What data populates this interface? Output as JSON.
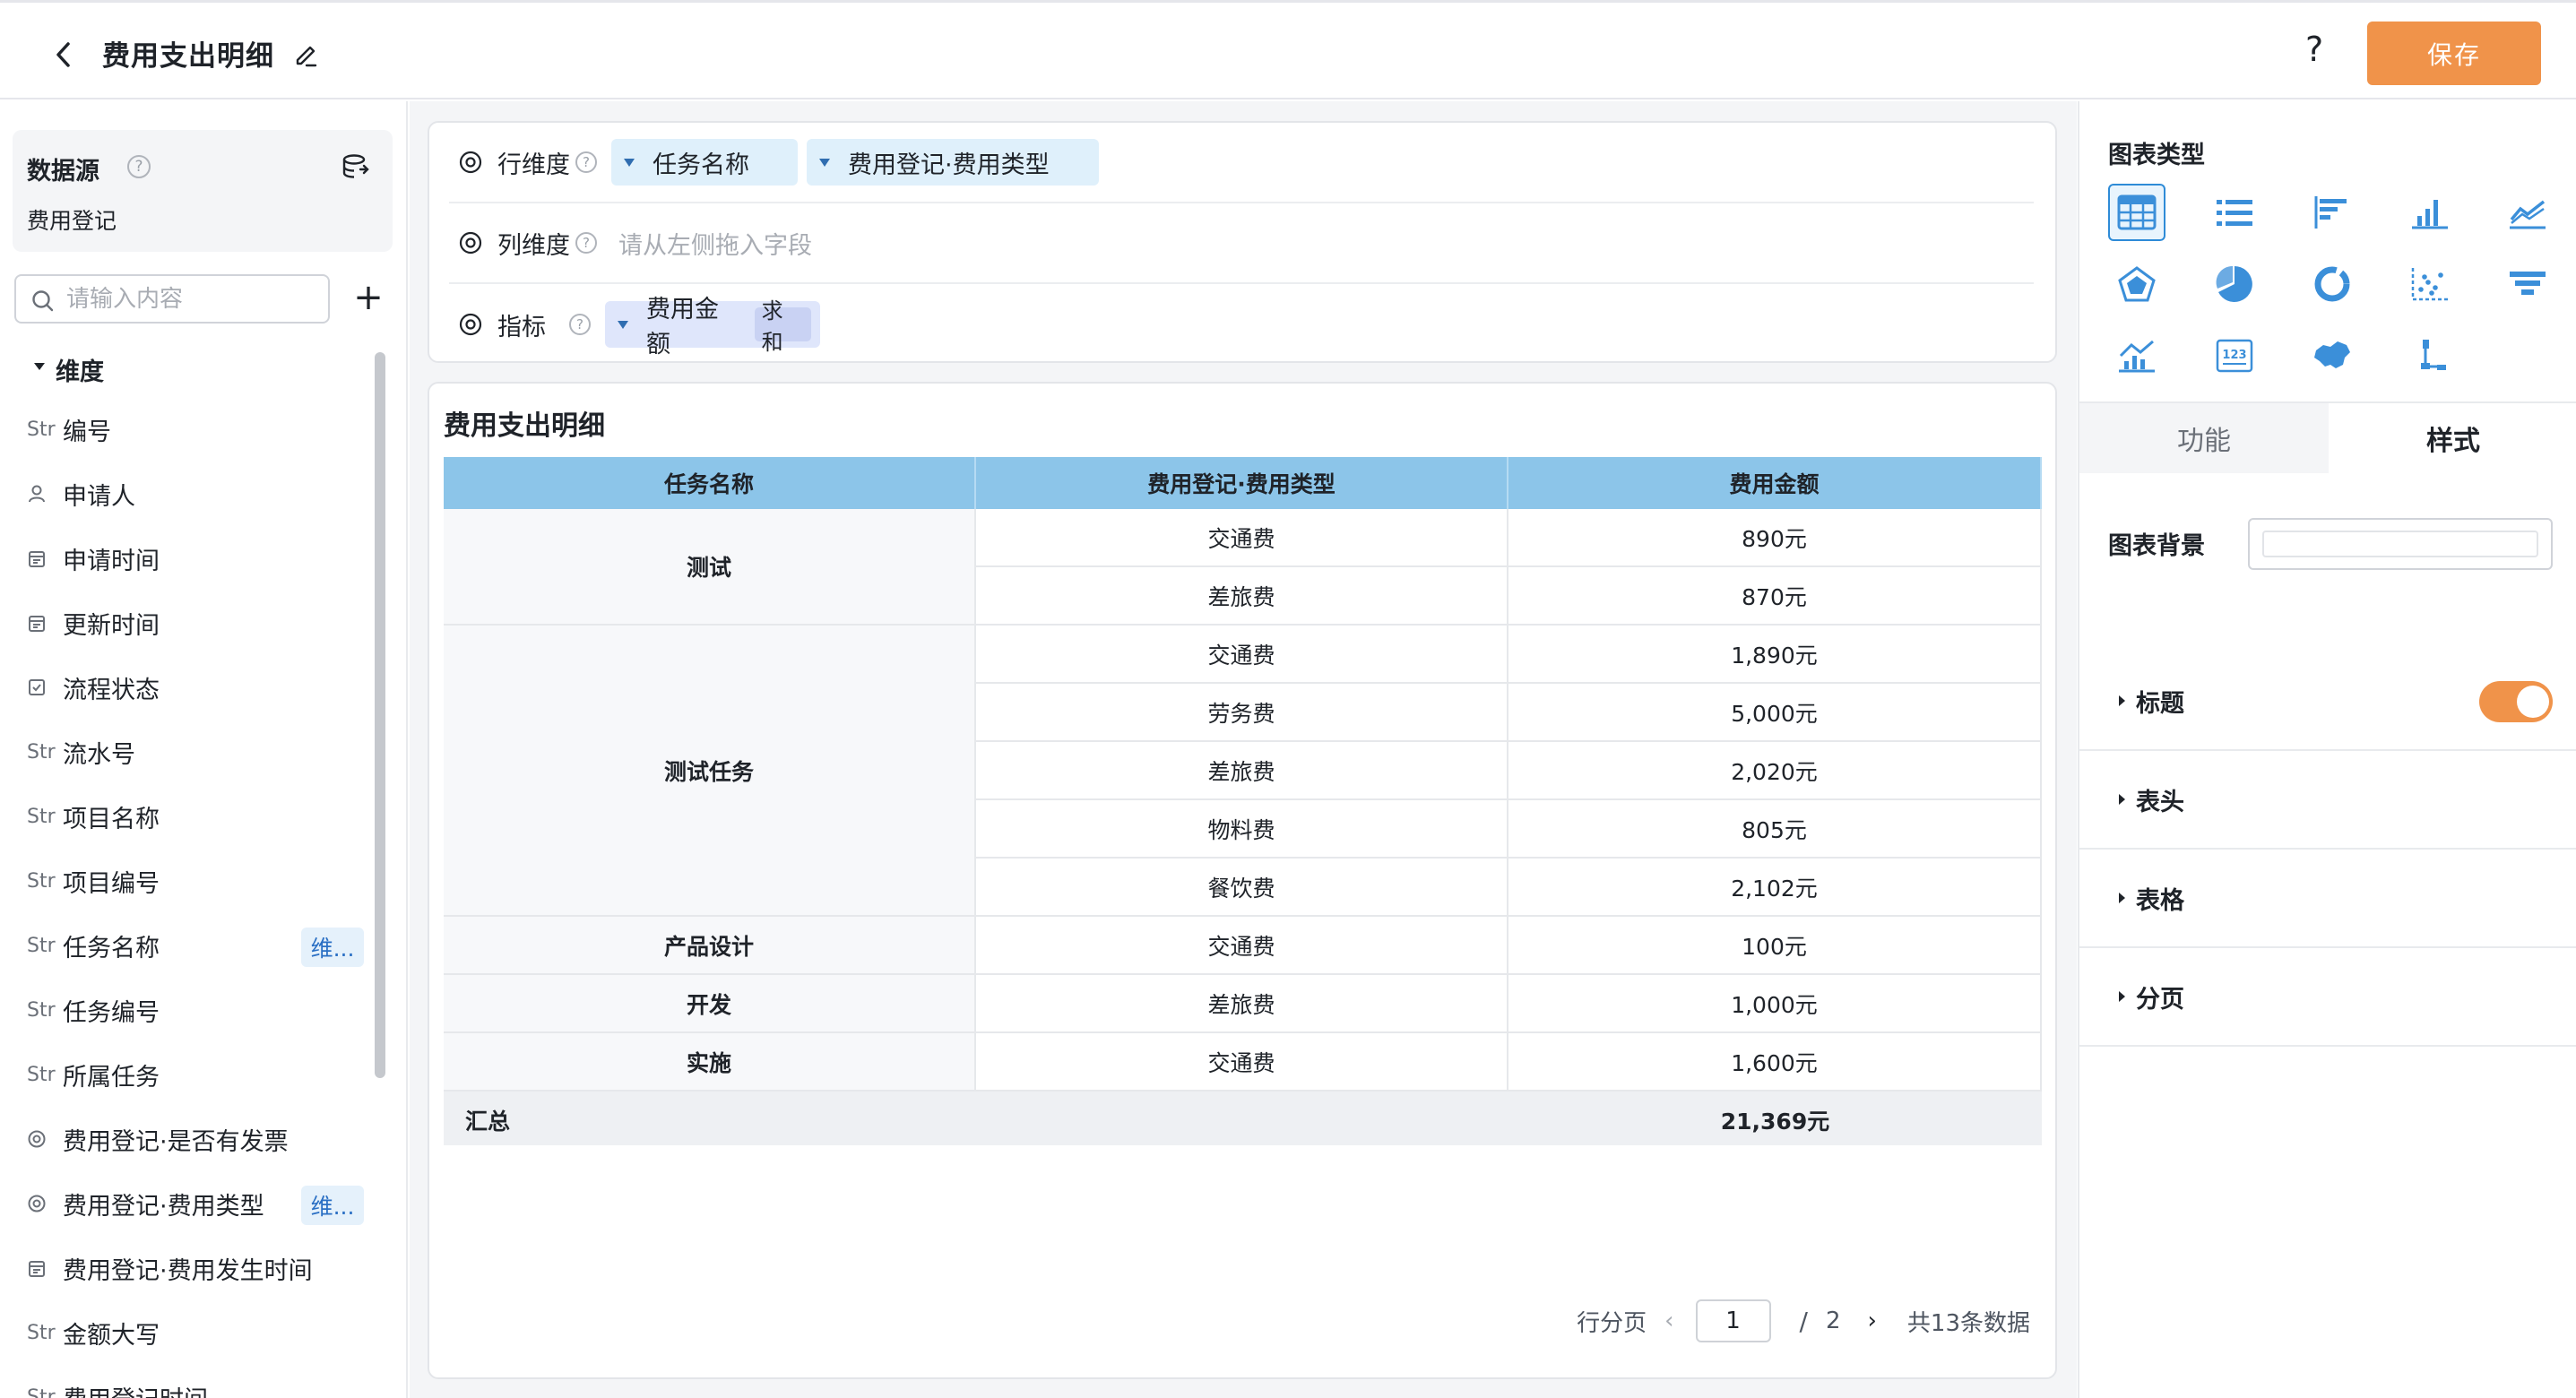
{
  "header": {
    "title": "费用支出明细",
    "help_label": "?",
    "save_label": "保存"
  },
  "left_panel": {
    "datasource_title": "数据源",
    "datasource_name": "费用登记",
    "search_placeholder": "请输入内容",
    "add_label": "+",
    "group_title": "维度",
    "fields": [
      {
        "icon": "str-icon",
        "icon_text": "Str",
        "label": "编号",
        "tag": ""
      },
      {
        "icon": "user-icon",
        "icon_text": "",
        "label": "申请人",
        "tag": ""
      },
      {
        "icon": "calendar-icon",
        "icon_text": "",
        "label": "申请时间",
        "tag": ""
      },
      {
        "icon": "calendar-icon",
        "icon_text": "",
        "label": "更新时间",
        "tag": ""
      },
      {
        "icon": "checkbox-icon",
        "icon_text": "",
        "label": "流程状态",
        "tag": ""
      },
      {
        "icon": "str-icon",
        "icon_text": "Str",
        "label": "流水号",
        "tag": ""
      },
      {
        "icon": "str-icon",
        "icon_text": "Str",
        "label": "项目名称",
        "tag": ""
      },
      {
        "icon": "str-icon",
        "icon_text": "Str",
        "label": "项目编号",
        "tag": ""
      },
      {
        "icon": "str-icon",
        "icon_text": "Str",
        "label": "任务名称",
        "tag": "维..."
      },
      {
        "icon": "str-icon",
        "icon_text": "Str",
        "label": "任务编号",
        "tag": ""
      },
      {
        "icon": "str-icon",
        "icon_text": "Str",
        "label": "所属任务",
        "tag": ""
      },
      {
        "icon": "radio-icon",
        "icon_text": "",
        "label": "费用登记·是否有发票",
        "tag": ""
      },
      {
        "icon": "radio-icon",
        "icon_text": "",
        "label": "费用登记·费用类型",
        "tag": "维..."
      },
      {
        "icon": "calendar-icon",
        "icon_text": "",
        "label": "费用登记·费用发生时间",
        "tag": ""
      },
      {
        "icon": "str-icon",
        "icon_text": "Str",
        "label": "金额大写",
        "tag": ""
      },
      {
        "icon": "str-icon",
        "icon_text": "Str",
        "label": "费用登记时间",
        "tag": ""
      }
    ]
  },
  "config": {
    "row_dim_label": "行维度",
    "row_pills": [
      "任务名称",
      "费用登记·费用类型"
    ],
    "col_dim_label": "列维度",
    "col_placeholder": "请从左侧拖入字段",
    "metric_label": "指标",
    "metric_pill": "费用金额",
    "metric_agg": "求和"
  },
  "table": {
    "title": "费用支出明细",
    "headers": [
      "任务名称",
      "费用登记·费用类型",
      "费用金额"
    ],
    "groups": [
      {
        "name": "测试",
        "rows": [
          [
            "交通费",
            "890元"
          ],
          [
            "差旅费",
            "870元"
          ]
        ]
      },
      {
        "name": "测试任务",
        "rows": [
          [
            "交通费",
            "1,890元"
          ],
          [
            "劳务费",
            "5,000元"
          ],
          [
            "差旅费",
            "2,020元"
          ],
          [
            "物料费",
            "805元"
          ],
          [
            "餐饮费",
            "2,102元"
          ]
        ]
      },
      {
        "name": "产品设计",
        "rows": [
          [
            "交通费",
            "100元"
          ]
        ]
      },
      {
        "name": "开发",
        "rows": [
          [
            "差旅费",
            "1,000元"
          ]
        ]
      },
      {
        "name": "实施",
        "rows": [
          [
            "交通费",
            "1,600元"
          ]
        ]
      }
    ],
    "total_label": "汇总",
    "total_value": "21,369元"
  },
  "pager": {
    "mode_label": "行分页",
    "current_page": "1",
    "separator": "/",
    "total_pages": "2",
    "total_text": "共13条数据"
  },
  "right_panel": {
    "chart_type_title": "图表类型",
    "chart_types": [
      "table-icon",
      "list-icon",
      "bar-horizontal-icon",
      "bar-vertical-icon",
      "line-icon",
      "radar-icon",
      "pie-icon",
      "donut-icon",
      "scatter-icon",
      "funnel-icon",
      "combo-icon",
      "number-card-icon",
      "map-icon",
      "tree-icon"
    ],
    "tabs": [
      "功能",
      "样式"
    ],
    "bg_label": "图表背景",
    "sections": [
      "标题",
      "表头",
      "表格",
      "分页"
    ],
    "title_toggle_on": true
  },
  "colors": {
    "accent": "#f0934a",
    "header_fill": "#8cc5e9",
    "pill_fill": "#dff0fb",
    "active_blue": "#2e8bd7"
  }
}
